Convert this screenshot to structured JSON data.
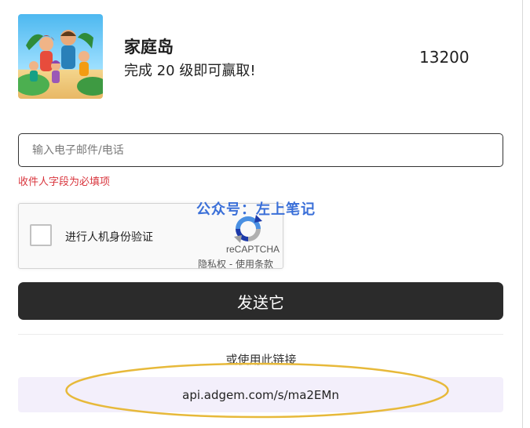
{
  "offer": {
    "title": "家庭岛",
    "description": "完成 20 级即可赢取!",
    "reward": "13200",
    "thumbnail_icon": "family-island-game-art"
  },
  "form": {
    "contact_placeholder": "输入电子邮件/电话",
    "contact_value": "",
    "error_message": "收件人字段为必填项",
    "submit_label": "发送它"
  },
  "watermark": "公众号：左上笔记",
  "captcha": {
    "label": "进行人机身份验证",
    "brand": "reCAPTCHA",
    "privacy_label": "隐私权",
    "separator": " - ",
    "terms_label": "使用条款",
    "icon": "recaptcha-logo"
  },
  "alt_link": {
    "label": "或使用此链接",
    "url": "api.adgem.com/s/ma2EMn"
  },
  "colors": {
    "error": "#d9363e",
    "button": "#2b2b2b",
    "link_bg": "#f3effb",
    "highlight": "#e7b93a",
    "watermark": "#3a6fd8"
  }
}
